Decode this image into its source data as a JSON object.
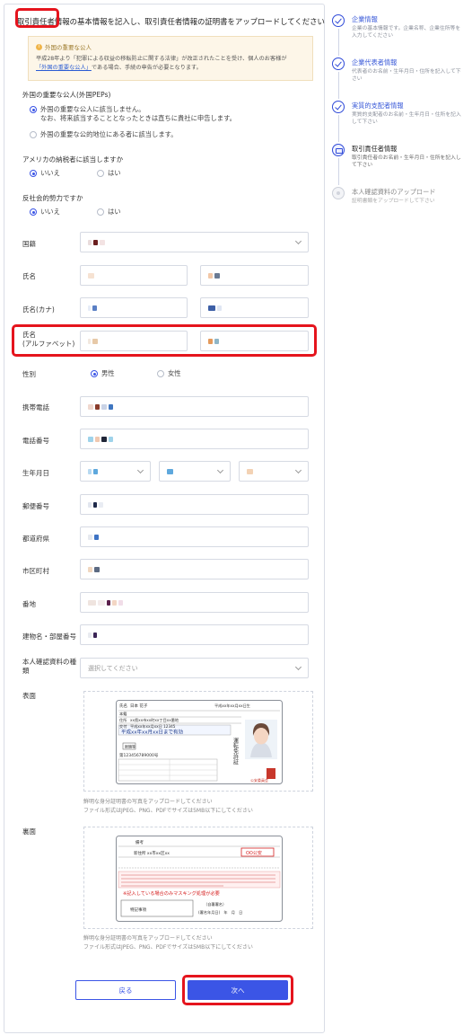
{
  "title": "取引責任者情報の基本情報を記入し、取引責任者情報の証明書をアップロードしてください",
  "notice": {
    "heading": "外国の重要な公人",
    "body_1": "平成28年より「犯罪による収益の移転防止に関する法律」が改正されたことを受け、個人のお客様が",
    "link": "「外国の重要な公人」",
    "body_2": "である場合、手続の申告が必要となります。"
  },
  "peps": {
    "label": "外国の重要な公人(外国PEPs)",
    "option_1": "外国の重要な公人に該当しません。",
    "option_1_sub": "なお、将来該当することとなったときは直ちに貴社に申告します。",
    "option_2": "外国の重要な公的地位にある者に該当します。"
  },
  "us_tax": {
    "label": "アメリカの納税者に該当しますか",
    "no": "いいえ",
    "yes": "はい"
  },
  "anti_social": {
    "label": "反社会的勢力ですか",
    "no": "いいえ",
    "yes": "はい"
  },
  "fields": {
    "country": "国籍",
    "name": "氏名",
    "name_kana": "氏名(カナ)",
    "name_alpha_1": "氏名",
    "name_alpha_2": "(アルファベット)",
    "gender": "性別",
    "gender_male": "男性",
    "gender_female": "女性",
    "mobile": "携帯電話",
    "phone": "電話番号",
    "birthday": "生年月日",
    "postal": "郵便番号",
    "prefecture": "都道府県",
    "city": "市区町村",
    "address": "番地",
    "building": "建物名・部屋番号",
    "id_type_1": "本人確認資料の種",
    "id_type_2": "類",
    "id_type_placeholder": "選択してください",
    "front": "表面",
    "back": "裏面"
  },
  "upload": {
    "hint_1": "鮮明な身分証明書の写真をアップロードしてください",
    "hint_2": "ファイル形式はJPEG、PNG、PDFでサイズは5MB以下にしてください"
  },
  "license_front": {
    "name_label": "氏名",
    "name": "日本 花子",
    "birth": "平成xx年xx月xx日生",
    "honseki": "本籍",
    "address_label": "住所",
    "address": "xx県xx市xx町xx丁目xx番地",
    "issue_label": "交付",
    "issue": "平成xx年xx月xx日 12345",
    "valid": "平成xx年xx月xx日まで有効",
    "cond": "眼鏡等",
    "number": "第123456789000号",
    "side_text": "運転免許証",
    "seal": "公安委員会"
  },
  "license_back": {
    "remarks": "備考",
    "new_address": "新住所 xx市xx区xx",
    "stamp": "OO公安",
    "mask_note": "※記入している場合のみマスキング処理が必要",
    "donor": "特記事項",
    "sign": "（自署署名）",
    "sign_date": "(署名年月日)　年　月　日"
  },
  "buttons": {
    "back": "戻る",
    "next": "次へ"
  },
  "steps": [
    {
      "title": "企業情報",
      "desc": "企業の基本情報です。企業名称、企業住所等を入力してください"
    },
    {
      "title": "企業代表者情報",
      "desc": "代表者のお名前・生年月日・住所を記入して下さい"
    },
    {
      "title": "実質的支配者情報",
      "desc": "実質的支配者のお名前・生年月日・住所を記入して下さい"
    },
    {
      "title": "取引責任者情報",
      "desc": "取引責任者のお名前・生年月日・住所を記入して下さい"
    },
    {
      "title": "本人確認資料のアップロード",
      "desc": "証明書類をアップロードして下さい"
    }
  ],
  "colors": {
    "accent": "#3b55e6",
    "highlight": "#e5141d",
    "notice_bg": "#fdf6e8"
  }
}
